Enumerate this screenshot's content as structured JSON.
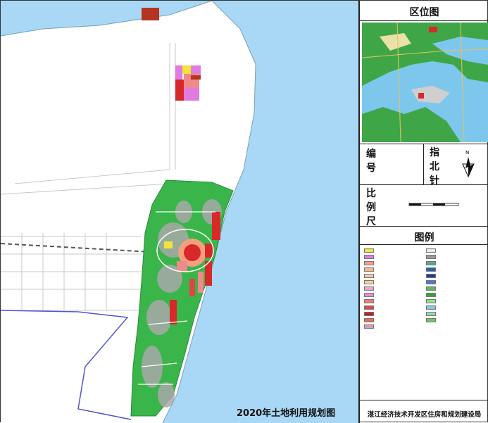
{
  "map": {
    "title": "2020年土地利用规划图"
  },
  "panel": {
    "location_title": "区位图",
    "serial_label": "编号",
    "north_label": "指北针",
    "scale_label": "比例尺",
    "legend_title": "图例",
    "footer": "湛江经济技术开发区住房和规划建设局"
  },
  "legend": [
    {
      "color": "#f2e33a"
    },
    {
      "color": "#e07be0"
    },
    {
      "color": "#f59f7f"
    },
    {
      "color": "#f7b98a"
    },
    {
      "color": "#f9c7a0"
    },
    {
      "color": "#f7d28f"
    },
    {
      "color": "#f3a2c9"
    },
    {
      "color": "#e88fd0"
    },
    {
      "color": "#f07a7a"
    },
    {
      "color": "#e04545"
    },
    {
      "color": "#c02020"
    },
    {
      "color": "#e56b5a"
    },
    {
      "color": "#d99bbf"
    },
    {
      "color": "#eaeaea"
    },
    {
      "color": "#999999"
    },
    {
      "color": "#4fa9a0"
    },
    {
      "color": "#2a5fa8"
    },
    {
      "color": "#1b3f8c"
    },
    {
      "color": "#4a7bd0"
    },
    {
      "color": "#5fb85f"
    },
    {
      "color": "#2ea82e"
    },
    {
      "color": "#8edc8e"
    },
    {
      "color": "#7fc7e8"
    },
    {
      "color": "#a0d8a0"
    },
    {
      "color": "#6ec56e"
    }
  ],
  "colors": {
    "sea": "#a8d8f5",
    "green": "#39b54a",
    "commercial": "#d8282a",
    "residential": "#f08a8a",
    "grey": "#a9a9a9"
  }
}
